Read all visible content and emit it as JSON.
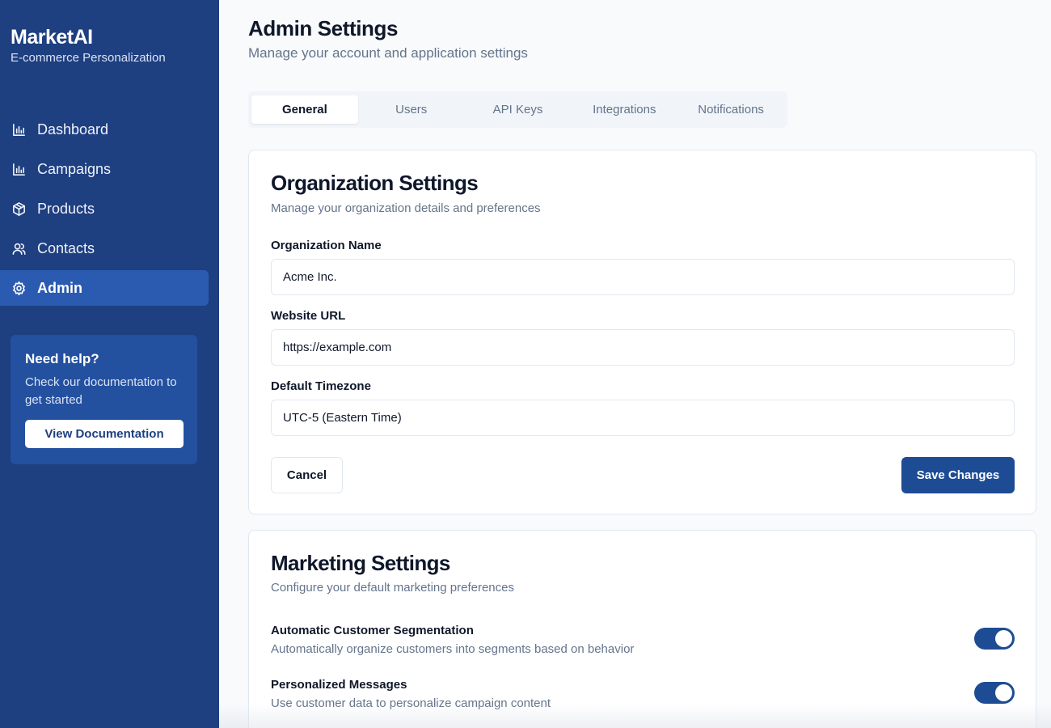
{
  "brand": {
    "name": "MarketAI",
    "subtitle": "E-commerce Personalization"
  },
  "sidebar": {
    "items": [
      {
        "label": "Dashboard",
        "icon": "bar-chart-icon",
        "active": false
      },
      {
        "label": "Campaigns",
        "icon": "bar-chart-icon",
        "active": false
      },
      {
        "label": "Products",
        "icon": "package-icon",
        "active": false
      },
      {
        "label": "Contacts",
        "icon": "users-icon",
        "active": false
      },
      {
        "label": "Admin",
        "icon": "gear-icon",
        "active": true
      }
    ],
    "help": {
      "title": "Need help?",
      "text": "Check our documentation to get started",
      "button": "View Documentation"
    }
  },
  "header": {
    "title": "Admin Settings",
    "subtitle": "Manage your account and application settings"
  },
  "tabs": [
    {
      "label": "General",
      "active": true
    },
    {
      "label": "Users",
      "active": false
    },
    {
      "label": "API Keys",
      "active": false
    },
    {
      "label": "Integrations",
      "active": false
    },
    {
      "label": "Notifications",
      "active": false
    }
  ],
  "org_settings": {
    "title": "Organization Settings",
    "description": "Manage your organization details and preferences",
    "fields": [
      {
        "label": "Organization Name",
        "value": "Acme Inc."
      },
      {
        "label": "Website URL",
        "value": "https://example.com"
      },
      {
        "label": "Default Timezone",
        "value": "UTC-5 (Eastern Time)"
      }
    ],
    "cancel_label": "Cancel",
    "save_label": "Save Changes"
  },
  "marketing_settings": {
    "title": "Marketing Settings",
    "description": "Configure your default marketing preferences",
    "preferences": [
      {
        "title": "Automatic Customer Segmentation",
        "description": "Automatically organize customers into segments based on behavior",
        "enabled": true
      },
      {
        "title": "Personalized Messages",
        "description": "Use customer data to personalize campaign content",
        "enabled": true
      }
    ]
  },
  "colors": {
    "sidebar_bg": "#1e3f80",
    "active_nav": "#2b5bb0",
    "primary_button": "#1e4c94",
    "toggle_on": "#1e4c94"
  }
}
